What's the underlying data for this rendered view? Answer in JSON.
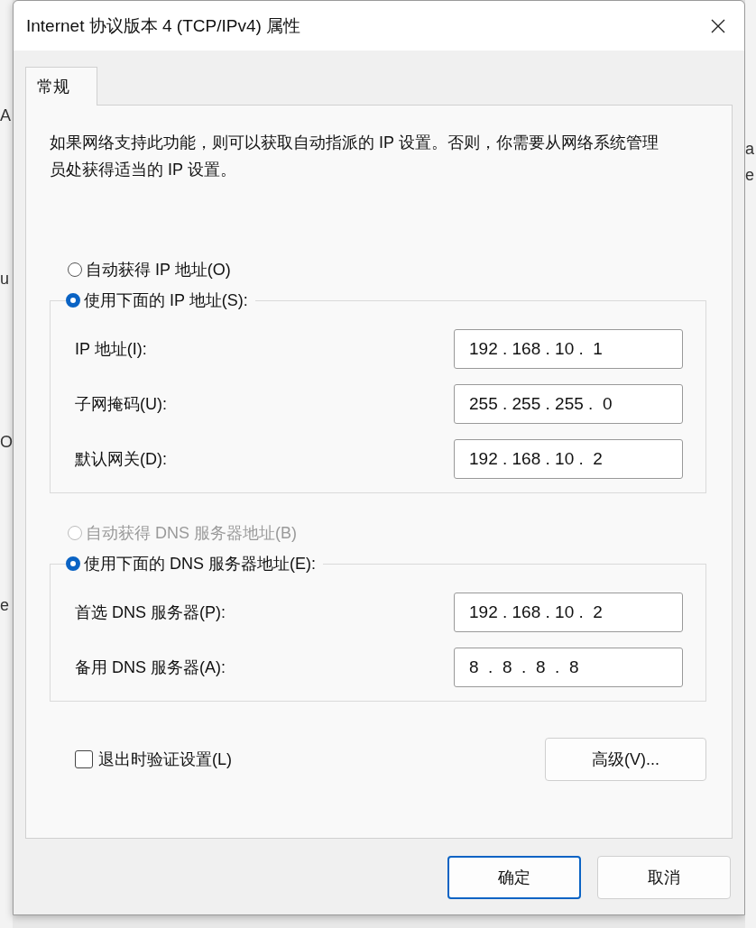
{
  "background_window": {
    "left_fragments": [
      "A",
      "u",
      "O",
      "e"
    ],
    "right_fragments": [
      "a",
      "e"
    ]
  },
  "window": {
    "title": "Internet 协议版本 4 (TCP/IPv4) 属性"
  },
  "tabs": [
    {
      "label": "常规",
      "selected": true
    }
  ],
  "description": "如果网络支持此功能，则可以获取自动指派的 IP 设置。否则，你需要从网络系统管理员处获得适当的 IP 设置。",
  "ip_section": {
    "options": [
      {
        "label": "自动获得 IP 地址(O)",
        "selected": false,
        "disabled": false
      },
      {
        "label": "使用下面的 IP 地址(S):",
        "selected": true,
        "disabled": false
      }
    ],
    "fields": [
      {
        "label": "IP 地址(I):",
        "value": "192 . 168 . 10 .  1"
      },
      {
        "label": "子网掩码(U):",
        "value": "255 . 255 . 255 .  0"
      },
      {
        "label": "默认网关(D):",
        "value": "192 . 168 . 10 .  2"
      }
    ]
  },
  "dns_section": {
    "options": [
      {
        "label": "自动获得 DNS 服务器地址(B)",
        "selected": false,
        "disabled": true
      },
      {
        "label": "使用下面的 DNS 服务器地址(E):",
        "selected": true,
        "disabled": false
      }
    ],
    "fields": [
      {
        "label": "首选 DNS 服务器(P):",
        "value": "192 . 168 . 10 .  2"
      },
      {
        "label": "备用 DNS 服务器(A):",
        "value": "8  .  8  .  8  .  8"
      }
    ]
  },
  "validate_checkbox": {
    "label": "退出时验证设置(L)",
    "checked": false
  },
  "advanced_button": "高级(V)...",
  "buttons": [
    {
      "label": "确定",
      "kind": "primary"
    },
    {
      "label": "取消",
      "kind": "normal"
    }
  ]
}
